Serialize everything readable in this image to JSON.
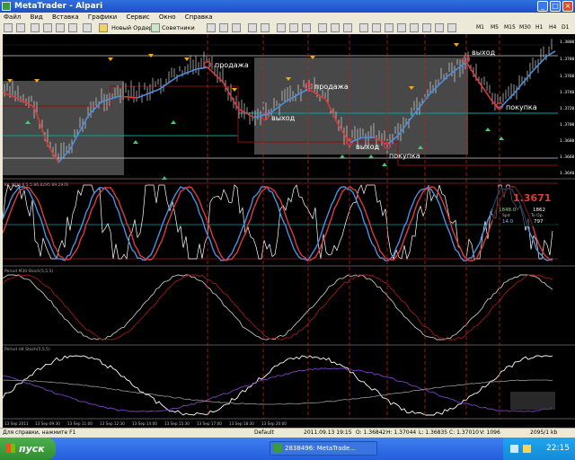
{
  "window": {
    "title": "MetaTrader - Alpari"
  },
  "menu": [
    "Файл",
    "Вид",
    "Вставка",
    "Графики",
    "Сервис",
    "Окно",
    "Справка"
  ],
  "toolbar": {
    "new_order": "Новый Ордер",
    "experts": "Советники"
  },
  "timeframes": [
    "M1",
    "M5",
    "M15",
    "M30",
    "H1",
    "H4",
    "D1"
  ],
  "chart": {
    "annotations": {
      "sell": "продажа",
      "exit": "выход",
      "buy": "покупка"
    },
    "price_labels": [
      "1.3800",
      "1.3780",
      "1.3760",
      "1.3740",
      "1.3720",
      "1.3700",
      "1.3680",
      "1.3660",
      "1.3640"
    ],
    "price_label_color": "#ffffff",
    "rsi_panel": {
      "label": "Ko_MDA 6.5.5 86.8295 89.2976",
      "value_big": "1.3671",
      "values": [
        [
          "1848.0",
          "1862"
        ],
        [
          "Spd",
          "To Op."
        ],
        [
          "14.0",
          "797"
        ]
      ]
    },
    "stoch1": {
      "label": "Period M30 Stoch(5,5,5)"
    },
    "stoch2": {
      "label": "Period H4 Stoch(5,5,5)"
    },
    "time_labels": [
      "13 Sep 2011",
      "13 Sep 09:30",
      "13 Sep 11:00",
      "13 Sep 12:30",
      "13 Sep 14:00",
      "13 Sep 15:30",
      "13 Sep 17:00",
      "13 Sep 18:30",
      "13 Sep 20:00"
    ],
    "colors": {
      "up": "#4a90e2",
      "down": "#e03a3a",
      "white": "#ffffff",
      "grid": "#1a1a1a",
      "zone": "#777777"
    }
  },
  "status": {
    "help": "Для справки, нажмите F1",
    "profile": "Default",
    "datetime": "2011.09.13 19:15",
    "o": "O: 1.36842",
    "h": "H: 1.37044",
    "l": "L: 1.36835",
    "c": "C: 1.37010",
    "v": "V: 1096",
    "conn": "2095/1 kb"
  },
  "taskbar": {
    "start": "пуск",
    "app": "2838496: MetaTrade...",
    "clock": "22:15"
  }
}
